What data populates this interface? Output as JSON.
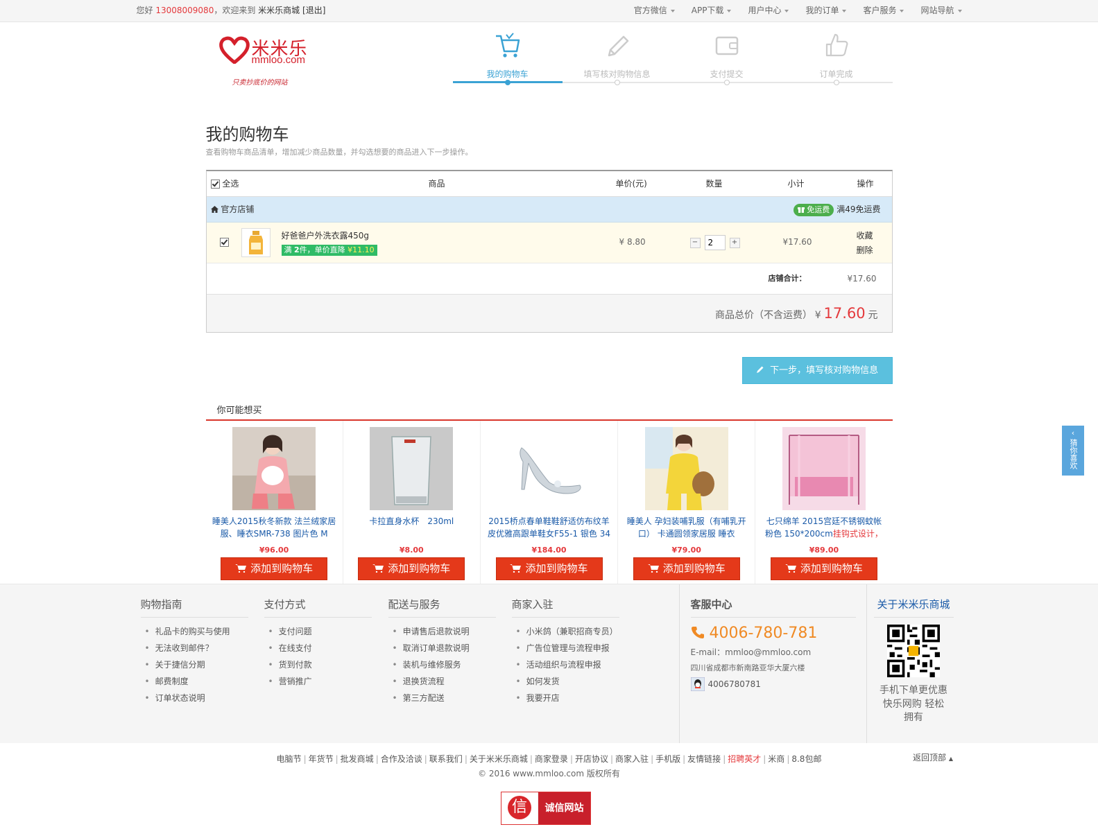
{
  "topbar": {
    "greeting": "您好",
    "phone": "13008009080",
    "welcome": "，欢迎来到",
    "site_name": "米米乐商城",
    "logout": "[退出]",
    "nav": [
      "官方微信",
      "APP下载",
      "用户中心",
      "我的订单",
      "客户服务",
      "网站导航"
    ]
  },
  "logo": {
    "cn": "米米乐",
    "en": "mmloo.com",
    "slogan": "只卖抄底价的网站"
  },
  "steps": [
    {
      "label": "我的购物车",
      "icon": "cart-icon",
      "active": true
    },
    {
      "label": "填写核对购物信息",
      "icon": "pencil-icon",
      "active": false
    },
    {
      "label": "支付提交",
      "icon": "wallet-icon",
      "active": false
    },
    {
      "label": "订单完成",
      "icon": "thumbs-up-icon",
      "active": false
    }
  ],
  "page": {
    "title": "我的购物车",
    "subtitle": "查看购物车商品清单，增加减少商品数量，并勾选想要的商品进入下一步操作。"
  },
  "cart": {
    "headers": {
      "select_all": "全选",
      "product": "商品",
      "unit_price": "单价(元)",
      "qty": "数量",
      "subtotal": "小计",
      "action": "操作"
    },
    "shop": {
      "name": "官方店铺",
      "free_badge": "免运费",
      "free_rule": "满49免运费"
    },
    "item": {
      "name": "好爸爸户外洗衣露450g",
      "promo_prefix": "满",
      "promo_count": "2",
      "promo_mid": "件，单价直降",
      "promo_amount": "¥11.10",
      "price": "¥ 8.80",
      "qty": "2",
      "subtotal": "¥17.60",
      "action_fav": "收藏",
      "action_del": "删除"
    },
    "shop_total_label": "店铺合计：",
    "shop_total": "¥17.60",
    "grand_total_label": "商品总价（不含运费）",
    "currency": "¥",
    "grand_total": "17.60",
    "unit": "元"
  },
  "next_button": "下一步，填写核对购物信息",
  "recommend": {
    "title": "你可能想买",
    "add_label": "添加到购物车",
    "items": [
      {
        "title": "睡美人2015秋冬新款 法兰绒家居服、睡衣SMR-738 图片色 M",
        "price": "¥96.00"
      },
      {
        "title": "卡拉直身水杯　230ml",
        "price": "¥8.00"
      },
      {
        "title": "2015桥点春单鞋鞋舒适仿布纹羊皮优雅高跟单鞋女F55-1 银色 34",
        "price": "¥184.00"
      },
      {
        "title": "睡美人 孕妇装哺乳服（有哺乳开口） 卡通圆领家居服 睡衣",
        "price": "¥79.00"
      },
      {
        "title_a": "七只绵羊 2015宫廷不锈钢蚊帐 粉色 150*200cm",
        "title_b": "挂钩式设计，便于",
        "price": "¥89.00"
      }
    ]
  },
  "footer": {
    "columns": [
      {
        "title": "购物指南",
        "items": [
          "礼品卡的购买与使用",
          "无法收到邮件？",
          "关于捷信分期",
          "邮费制度",
          "订单状态说明"
        ]
      },
      {
        "title": "支付方式",
        "items": [
          "支付问题",
          "在线支付",
          "货到付款",
          "营销推广"
        ]
      },
      {
        "title": "配送与服务",
        "items": [
          "申请售后退款说明",
          "取消订单退款说明",
          "装机与维修服务",
          "退换货流程",
          "第三方配送"
        ]
      },
      {
        "title": "商家入驻",
        "items": [
          "小米鸽（兼职招商专员）",
          "广告位管理与流程申报",
          "活动组织与流程申报",
          "如何发货",
          "我要开店"
        ]
      }
    ],
    "service": {
      "title": "客服中心",
      "phone": "4006-780-781",
      "email": "E-mail：mmloo@mmloo.com",
      "address": "四川省成都市新南路亚华大厦六楼",
      "qq": "4006780781"
    },
    "about": {
      "title": "关于米米乐商城",
      "text1": "手机下单更优惠",
      "text2": "快乐网购 轻松",
      "text3": "拥有"
    }
  },
  "bottom": {
    "links": [
      "电脑节",
      "年货节",
      "批发商城",
      "合作及洽谈",
      "联系我们",
      "关于米米乐商城",
      "商家登录",
      "开店协议",
      "商家入驻",
      "手机版",
      "友情链接",
      "招聘英才",
      "米商",
      "8.8包邮"
    ],
    "copyright": "© 2016 www.mmloo.com 版权所有",
    "back_top": "返回顶部",
    "trust_badge": "诚信网站",
    "trust_char": "信"
  },
  "side_tab": "猜你喜欢",
  "colors": {
    "accent": "#3aa2d4",
    "brand": "#d4202b",
    "buy": "#e4391a",
    "price": "#e4393c"
  }
}
